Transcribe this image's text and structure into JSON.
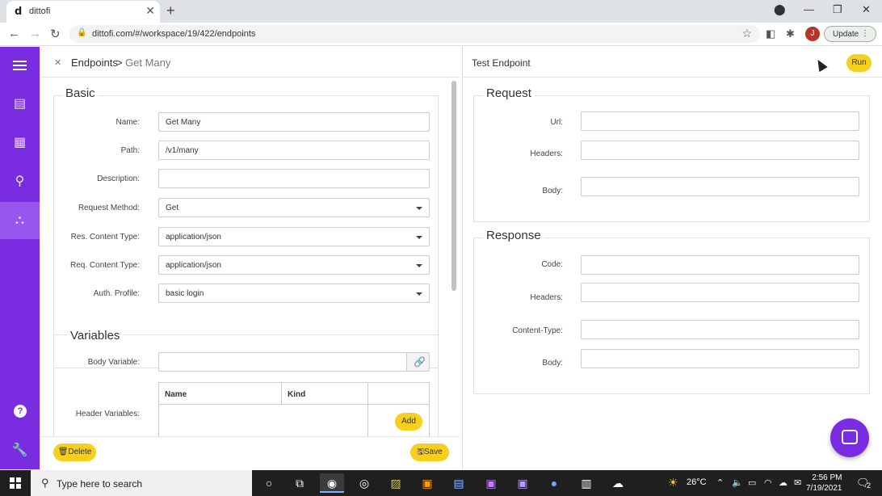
{
  "browser": {
    "tab_title": "dittofi",
    "tab_favicon": "d",
    "url": "dittofi.com/#/workspace/19/422/endpoints",
    "profile_initial": "J",
    "update_label": "Update"
  },
  "sidebar": {
    "items": [
      {
        "icon": "menu-icon"
      },
      {
        "icon": "table-icon"
      },
      {
        "icon": "grid-icon"
      },
      {
        "icon": "search-icon"
      },
      {
        "icon": "network-icon",
        "active": true
      }
    ],
    "help": "?"
  },
  "breadcrumb": {
    "root": "Endpoints",
    "separator": ">",
    "current": "Get Many"
  },
  "basic": {
    "legend": "Basic",
    "fields": [
      {
        "label": "Name:",
        "value": "Get Many"
      },
      {
        "label": "Path:",
        "value": "/v1/many"
      },
      {
        "label": "Description:",
        "value": ""
      },
      {
        "label": "Request Method:",
        "value": "Get"
      },
      {
        "label": "Res. Content Type:",
        "value": "application/json"
      },
      {
        "label": "Req. Content Type:",
        "value": "application/json"
      },
      {
        "label": "Auth. Profile:",
        "value": "basic login"
      }
    ]
  },
  "variables": {
    "legend": "Variables",
    "body_label": "Body Variable:",
    "body_value": "",
    "header_label": "Header Variables:",
    "col_name": "Name",
    "col_kind": "Kind",
    "add_label": "Add"
  },
  "actions": {
    "delete": "Delete",
    "save": "Save"
  },
  "test": {
    "title": "Test Endpoint",
    "run": "Run",
    "request": {
      "legend": "Request",
      "url_label": "Url:",
      "headers_label": "Headers:",
      "body_label": "Body:"
    },
    "response": {
      "legend": "Response",
      "code_label": "Code:",
      "headers_label": "Headers:",
      "ctype_label": "Content-Type:",
      "body_label": "Body:"
    }
  },
  "taskbar": {
    "search_placeholder": "Type here to search",
    "temperature": "26°C",
    "time": "2:56 PM",
    "date": "7/19/2021",
    "notif_count": "2"
  },
  "colors": {
    "brand": "#7a2ce0",
    "accent": "#f7cf1f"
  }
}
